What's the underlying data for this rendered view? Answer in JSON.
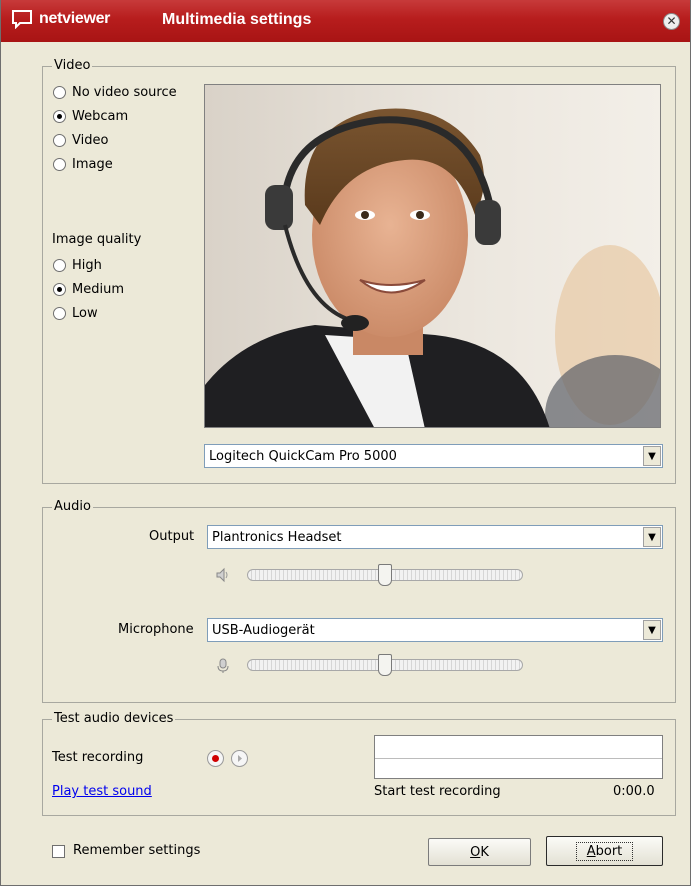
{
  "window": {
    "brand": "netviewer",
    "title": "Multimedia settings"
  },
  "video": {
    "legend": "Video",
    "sources": [
      {
        "label": "No video source",
        "checked": false
      },
      {
        "label": "Webcam",
        "checked": true
      },
      {
        "label": "Video",
        "checked": false
      },
      {
        "label": "Image",
        "checked": false
      }
    ],
    "quality_label": "Image quality",
    "qualities": [
      {
        "label": "High",
        "checked": false
      },
      {
        "label": "Medium",
        "checked": true
      },
      {
        "label": "Low",
        "checked": false
      }
    ],
    "device": "Logitech QuickCam Pro 5000"
  },
  "audio": {
    "legend": "Audio",
    "output_label": "Output",
    "output_device": "Plantronics Headset",
    "output_volume": 0.5,
    "mic_label": "Microphone",
    "mic_device": "USB-Audiogerät",
    "mic_volume": 0.5
  },
  "test": {
    "legend": "Test audio devices",
    "recording_label": "Test recording",
    "play_link": "Play test sound",
    "status": "Start test recording",
    "time": "0:00.0"
  },
  "footer": {
    "remember_label": "Remember settings",
    "remember_checked": false,
    "ok_mnemonic": "O",
    "ok_rest": "K",
    "abort_mnemonic": "A",
    "abort_rest": "bort"
  }
}
